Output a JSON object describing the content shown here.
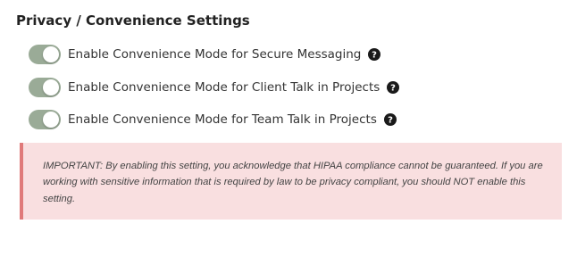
{
  "colors": {
    "toggle_on": "#9aab97",
    "warning_bg": "#f9dfe0",
    "warning_border": "#e07a7a",
    "help_icon": "#1a1a1a"
  },
  "section": {
    "title": "Privacy / Convenience Settings"
  },
  "settings": [
    {
      "label": "Enable Convenience Mode for Secure Messaging",
      "enabled": true,
      "icon": "question-circle-icon"
    },
    {
      "label": "Enable Convenience Mode for Client Talk in Projects",
      "enabled": true,
      "icon": "question-circle-icon"
    },
    {
      "label": "Enable Convenience Mode for Team Talk in Projects",
      "enabled": true,
      "icon": "question-circle-icon"
    }
  ],
  "warning": {
    "text": "IMPORTANT: By enabling this setting, you acknowledge that HIPAA compliance cannot be guaranteed. If you are working with sensitive information that is required by law to be privacy compliant, you should NOT enable this setting."
  }
}
